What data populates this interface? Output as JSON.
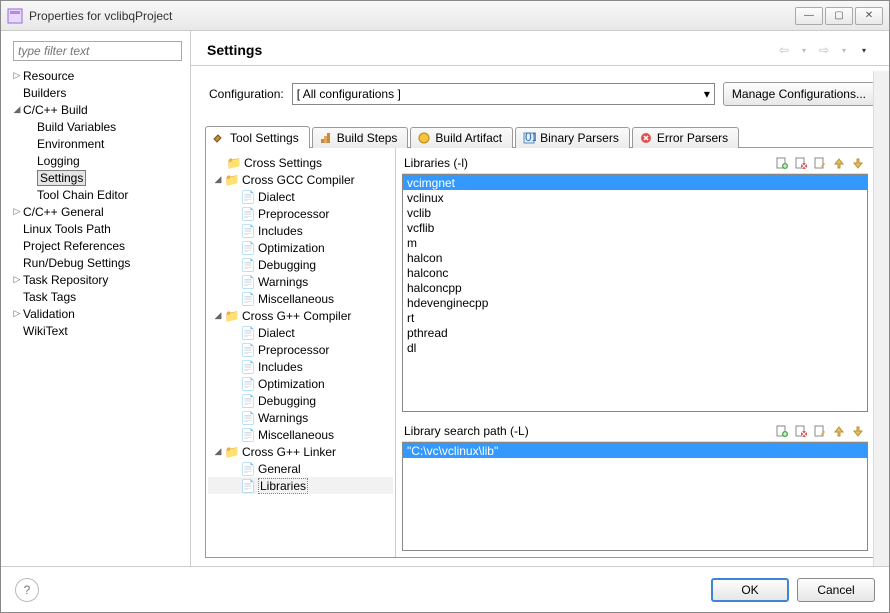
{
  "window": {
    "title": "Properties for vclibqProject"
  },
  "filter": {
    "placeholder": "type filter text"
  },
  "leftTree": {
    "resource": "Resource",
    "builders": "Builders",
    "ccbuild": "C/C++ Build",
    "buildvars": "Build Variables",
    "environment": "Environment",
    "logging": "Logging",
    "settings": "Settings",
    "toolchain": "Tool Chain Editor",
    "ccgeneral": "C/C++ General",
    "linuxtools": "Linux Tools Path",
    "projrefs": "Project References",
    "rundebug": "Run/Debug Settings",
    "taskrepo": "Task Repository",
    "tasktags": "Task Tags",
    "validation": "Validation",
    "wikitext": "WikiText"
  },
  "header": {
    "title": "Settings"
  },
  "config": {
    "label": "Configuration:",
    "value": "[ All configurations ]",
    "manage": "Manage Configurations..."
  },
  "tabs": {
    "tool": "Tool Settings",
    "steps": "Build Steps",
    "artifact": "Build Artifact",
    "binary": "Binary Parsers",
    "error": "Error Parsers"
  },
  "settingsTree": {
    "crossSettings": "Cross Settings",
    "gccCompiler": "Cross GCC Compiler",
    "dialect": "Dialect",
    "preprocessor": "Preprocessor",
    "includes": "Includes",
    "optimization": "Optimization",
    "debugging": "Debugging",
    "warnings": "Warnings",
    "misc": "Miscellaneous",
    "gppCompiler": "Cross G++ Compiler",
    "gppLinker": "Cross G++ Linker",
    "general": "General",
    "libraries": "Libraries"
  },
  "detail": {
    "libs": {
      "title": "Libraries (-l)",
      "items": [
        "vcimgnet",
        "vclinux",
        "vclib",
        "vcflib",
        "m",
        "halcon",
        "halconc",
        "halconcpp",
        "hdevenginecpp",
        "rt",
        "pthread",
        "dl"
      ]
    },
    "paths": {
      "title": "Library search path (-L)",
      "items": [
        "\"C:\\vc\\vclinux\\lib\""
      ]
    }
  },
  "footer": {
    "ok": "OK",
    "cancel": "Cancel"
  }
}
